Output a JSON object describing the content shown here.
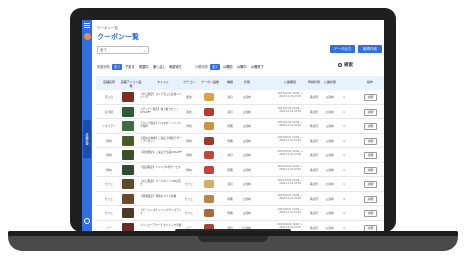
{
  "breadcrumb": "クーポン一覧",
  "page_title": "クーポン一覧",
  "filter_select": {
    "value": "全て"
  },
  "buttons": {
    "csv": "データ出力",
    "create": "新規作成"
  },
  "side_tab": "店舗管理",
  "filters": {
    "label1": "掲載状態",
    "chips1": [
      {
        "label": "全て",
        "active": true
      },
      {
        "label": "下書き",
        "active": false
      },
      {
        "label": "掲載中",
        "active": false
      },
      {
        "label": "差し戻し",
        "active": false
      },
      {
        "label": "承認待ち",
        "active": false
      }
    ],
    "label2": "公開状態",
    "chips2": [
      {
        "label": "全て",
        "active": true
      },
      {
        "label": "公開前",
        "active": false
      },
      {
        "label": "公開中",
        "active": false
      },
      {
        "label": "公開終了",
        "active": false
      }
    ]
  },
  "search": {
    "label": "検索"
  },
  "table": {
    "headers": [
      "店舗名称",
      "店舗アイコン画像",
      "タイトル",
      "カテゴリ",
      "クーポン画像",
      "種類",
      "状態",
      "公開期間",
      "申請状態",
      "公開状態",
      "操作"
    ],
    "rows": [
      {
        "store": "天ぷら",
        "title": "【平日限定】ランチ天ぷら定食+ドリンク",
        "category": "和食",
        "type": "割引",
        "status": "公開中",
        "period": "2023-01-01 10:00 〜 2023-12-31 23:59",
        "apply": "承認済",
        "pub": "公開中",
        "n": "1",
        "action": "詳細",
        "thumb": "#7a2f22",
        "food": "#d9a441"
      },
      {
        "store": "寿司屋",
        "title": "【ディナー限定】特上握りセット10%OFF",
        "category": "和食",
        "type": "割引",
        "status": "公開中",
        "period": "2023-01-01 10:00 〜 2023-12-31 23:59",
        "apply": "承認済",
        "pub": "公開中",
        "n": "1",
        "action": "詳細",
        "thumb": "#2f5a36",
        "food": "#b73a2c"
      },
      {
        "store": "イタリアン",
        "title": "【ランチ限定】パスタセットドリンク無料",
        "category": "洋食",
        "type": "特典",
        "status": "公開中",
        "period": "2023-02-01 10:00 〜 2023-12-31 23:59",
        "apply": "承認済",
        "pub": "公開中",
        "n": "1",
        "action": "詳細",
        "thumb": "#3e6b3f",
        "food": "#c99442"
      },
      {
        "store": "焼肉",
        "title": "【誕生日特典】ご来店で特製デザートプレゼント",
        "category": "焼肉",
        "type": "特典",
        "status": "公開中",
        "period": "2023-03-01 10:00 〜 2023-12-31 23:59",
        "apply": "承認済",
        "pub": "公開中",
        "n": "1",
        "action": "詳細",
        "thumb": "#4a5a2a",
        "food": "#9c3b2a"
      },
      {
        "store": "焼肉",
        "title": "【新規限定】ご来店で全品10%OFF",
        "category": "焼肉",
        "type": "割引",
        "status": "公開中",
        "period": "2023-03-01 10:00 〜 2023-12-31 23:59",
        "apply": "承認済",
        "pub": "公開中",
        "n": "1",
        "action": "詳細",
        "thumb": "#3d4f2a",
        "food": "#c0473a"
      },
      {
        "store": "焼肉",
        "title": "【会員限定】ドリンク1杯サービス",
        "category": "焼肉",
        "type": "特典",
        "status": "公開中",
        "period": "2023-04-01 10:00 〜 2023-12-31 23:59",
        "apply": "承認済",
        "pub": "公開中",
        "n": "1",
        "action": "詳細",
        "thumb": "#2f4a30",
        "food": "#c7413a"
      },
      {
        "store": "カフェ",
        "title": "【平日限定】ケーキセット100円引き",
        "category": "カフェ",
        "type": "割引",
        "status": "公開中",
        "period": "2023-04-01 10:00 〜 2023-12-31 23:59",
        "apply": "承認済",
        "pub": "公開中",
        "n": "1",
        "action": "詳細",
        "thumb": "#5a4a2a",
        "food": "#d1ad6a"
      },
      {
        "store": "カフェ",
        "title": "【期間限定】季節のパフェ特典",
        "category": "カフェ",
        "type": "特典",
        "status": "公開中",
        "period": "2023-05-01 10:00 〜 2023-12-31 23:59",
        "apply": "承認済",
        "pub": "公開中",
        "n": "1",
        "action": "詳細",
        "thumb": "#6a4a2a",
        "food": "#b5864a"
      },
      {
        "store": "カフェ",
        "title": "【モーニング】ドリンクサイズアップ",
        "category": "カフェ",
        "type": "特典",
        "status": "公開中",
        "period": "2023-05-01 10:00 〜 2023-12-31 23:59",
        "apply": "承認済",
        "pub": "公開中",
        "n": "1",
        "action": "詳細",
        "thumb": "#4a3a2a",
        "food": "#a66a3a"
      },
      {
        "store": "バー",
        "title": "【ハッピーアワー】全ドリンク半額",
        "category": "バー",
        "type": "割引",
        "status": "公開中",
        "period": "2023-06-01 10:00 〜 2023-12-31 23:59",
        "apply": "承認済",
        "pub": "公開中",
        "n": "1",
        "action": "詳細",
        "thumb": "#6a2a2a",
        "food": "#9a4a3a"
      }
    ]
  },
  "colors": {
    "accent": "#2f6fe0",
    "header_bg": "#e9f1fc"
  }
}
